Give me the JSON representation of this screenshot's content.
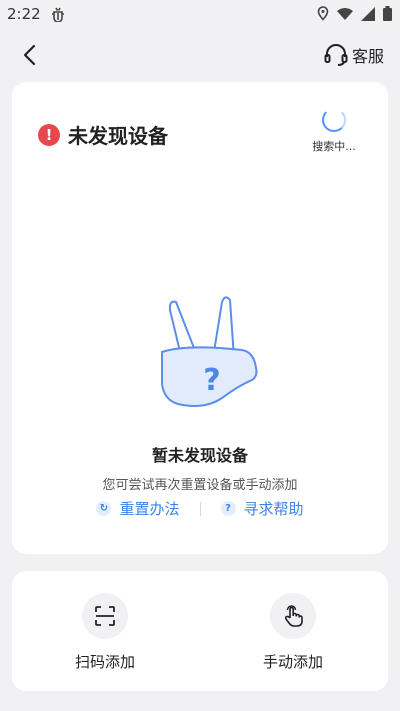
{
  "status_bar": {
    "time": "2:22"
  },
  "nav": {
    "service_label": "客服"
  },
  "device_status": {
    "title": "未发现设备",
    "searching_label": "搜索中..."
  },
  "empty_state": {
    "title": "暂未发现设备",
    "description": "您可尝试再次重置设备或手动添加",
    "reset_link": "重置办法",
    "help_link": "寻求帮助"
  },
  "actions": {
    "scan_label": "扫码添加",
    "manual_label": "手动添加"
  },
  "colors": {
    "accent": "#3f82e8",
    "alert": "#e5484d",
    "background": "#f1f1f4"
  }
}
